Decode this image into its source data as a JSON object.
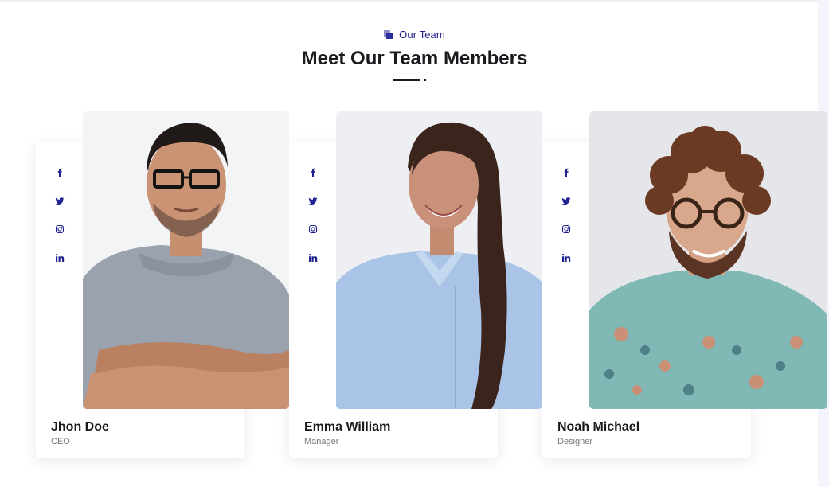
{
  "section": {
    "eyebrow": "Our Team",
    "title": "Meet Our Team Members"
  },
  "social_icons": [
    "facebook-icon",
    "twitter-icon",
    "instagram-icon",
    "linkedin-icon"
  ],
  "colors": {
    "accent": "#1f2190",
    "heading": "#1b1b1f",
    "muted": "#77777e",
    "card_bg": "#ffffff"
  },
  "members": [
    {
      "name": "Jhon Doe",
      "role": "CEO"
    },
    {
      "name": "Emma William",
      "role": "Manager"
    },
    {
      "name": "Noah Michael",
      "role": "Designer"
    }
  ]
}
